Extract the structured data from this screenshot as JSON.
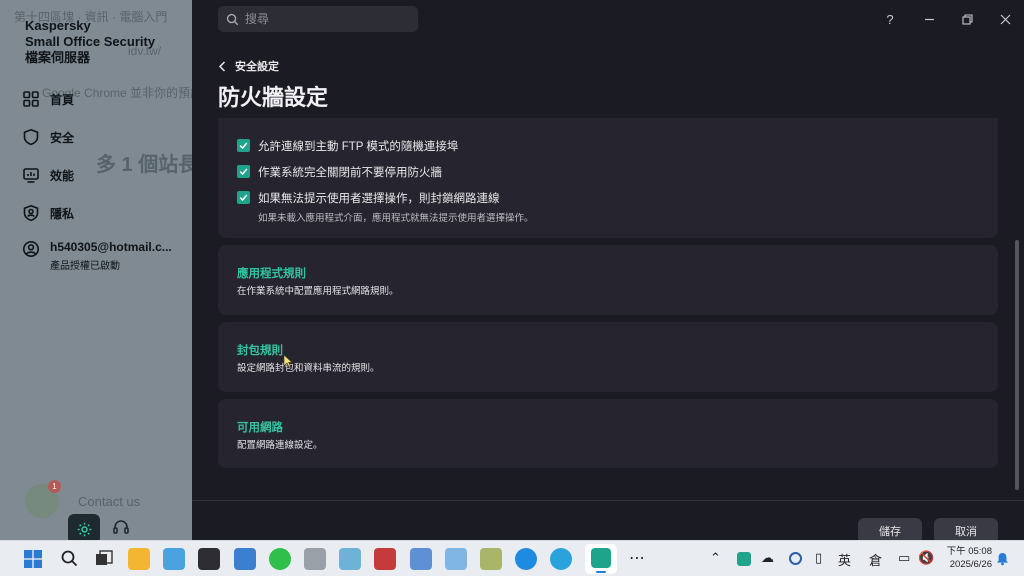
{
  "app": {
    "brand_line1": "Kaspersky",
    "brand_line2": "Small Office Security",
    "brand_line3": "檔案伺服器"
  },
  "background_ghost": {
    "tab_text": "第十四區塊 · 資訊 · 電腦入門",
    "url_text": "idv.tw/",
    "chrome_text": "Google Chrome 並非你的預設瀏",
    "big_text": "多 1 個站長",
    "contact_text": "Contact us",
    "badge": "1"
  },
  "sidebar": {
    "items": [
      {
        "label": "首頁",
        "icon": "home-grid-icon"
      },
      {
        "label": "安全",
        "icon": "shield-icon"
      },
      {
        "label": "效能",
        "icon": "performance-icon"
      },
      {
        "label": "隱私",
        "icon": "privacy-shield-icon"
      }
    ],
    "account": {
      "email": "h540305@hotmail.c...",
      "status": "產品授權已啟動"
    }
  },
  "search": {
    "placeholder": "搜尋"
  },
  "window": {
    "help": "?"
  },
  "header": {
    "back_label": "安全設定",
    "title": "防火牆設定"
  },
  "options_card": {
    "items": [
      {
        "label": "允許連線到主動 FTP 模式的隨機連接埠",
        "checked": true
      },
      {
        "label": "作業系統完全關閉前不要停用防火牆",
        "checked": true
      },
      {
        "label": "如果無法提示使用者選擇操作，則封鎖網路連線",
        "checked": true,
        "sub": "如果未載入應用程式介面，應用程式就無法提示使用者選擇操作。"
      }
    ]
  },
  "cards": [
    {
      "title": "應用程式規則",
      "desc": "在作業系統中配置應用程式網路規則。"
    },
    {
      "title": "封包規則",
      "desc": "設定網路封包和資料串流的規則。"
    },
    {
      "title": "可用網路",
      "desc": "配置網路連線設定。"
    }
  ],
  "footer": {
    "save_label": "儲存",
    "cancel_label": "取消"
  },
  "taskbar": {
    "ime_lang": "英",
    "ime_mode": "倉",
    "time": "下午 05:08",
    "date": "2025/6/26"
  },
  "colors": {
    "accent": "#34c2a0",
    "checkbox": "#1fa38a",
    "sidebar_bg": "#7f8a92",
    "main_bg": "#1b1b23",
    "card_bg": "#26252f"
  }
}
